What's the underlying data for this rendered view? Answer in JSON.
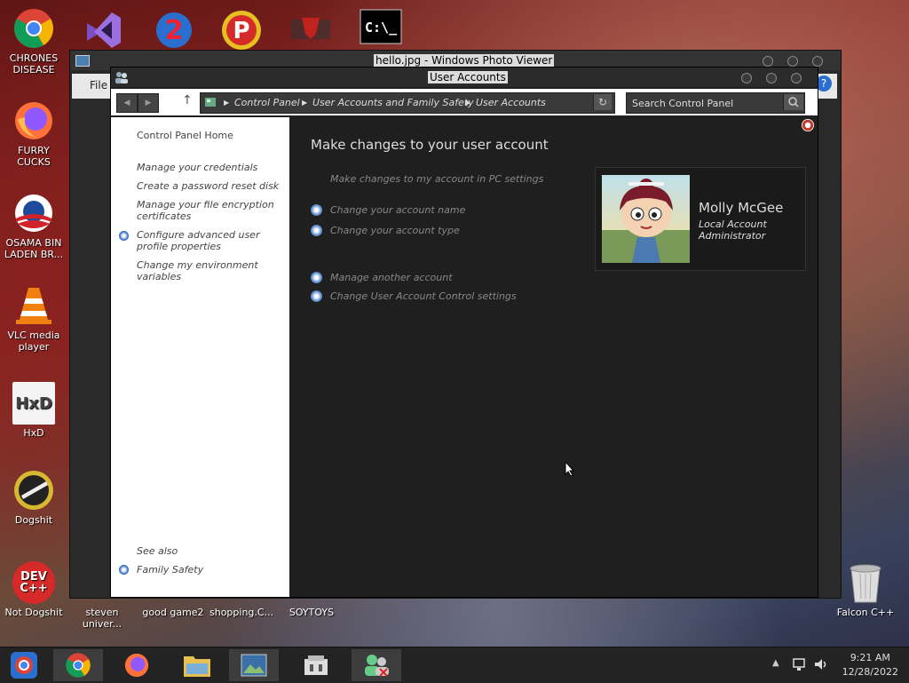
{
  "desktop": {
    "icons": [
      {
        "label": "CHRONES DISEASE",
        "icon": "chrome-icon"
      },
      {
        "label": "FURRY CUCKS",
        "icon": "firefox-icon"
      },
      {
        "label": "OSAMA BIN LADEN BR...",
        "icon": "obama-logo-icon"
      },
      {
        "label": "VLC media player",
        "icon": "vlc-icon"
      },
      {
        "label": "HxD",
        "icon": "hxd-icon"
      },
      {
        "label": "Dogshit",
        "icon": "dogshit-icon"
      },
      {
        "label": "Not Dogshit",
        "icon": "devcpp-icon"
      },
      {
        "label": "steven univer...",
        "icon": "file-icon"
      },
      {
        "label": "good game2",
        "icon": "file-icon"
      },
      {
        "label": "shopping.C...",
        "icon": "file-icon"
      },
      {
        "label": "SOYTOYS",
        "icon": "file-icon"
      },
      {
        "label": "Falcon C++",
        "icon": "recycle-bin-icon"
      }
    ],
    "devcpp_text": "DEV\nC++",
    "hxd_text": "HxD",
    "cmd_text": "C:\\_"
  },
  "photo_viewer": {
    "title": "hello.jpg - Windows Photo Viewer",
    "menu_file": "File"
  },
  "window": {
    "title": "User Accounts",
    "breadcrumb": [
      "Control Panel",
      "User Accounts and Family Safety",
      "User Accounts"
    ],
    "search_placeholder": "Search Control Panel"
  },
  "sidebar": {
    "home": "Control Panel Home",
    "links": [
      "Manage your credentials",
      "Create a password reset disk",
      "Manage your file encryption certificates",
      "Configure advanced user profile properties",
      "Change my environment variables"
    ],
    "see_also": "See also",
    "family_safety": "Family Safety"
  },
  "main": {
    "heading": "Make changes to your user account",
    "pc_settings": "Make changes to my account in PC settings",
    "tasks": [
      "Change your account name",
      "Change your account type",
      "Manage another account",
      "Change User Account Control settings"
    ]
  },
  "account": {
    "name": "Molly McGee",
    "type": "Local Account",
    "role": "Administrator"
  },
  "taskbar": {
    "time": "9:21 AM",
    "date": "12/28/2022"
  },
  "colors": {
    "accent": "#3a74c4",
    "window_bg": "#1f1f1f",
    "sidebar_bg": "#ffffff"
  }
}
